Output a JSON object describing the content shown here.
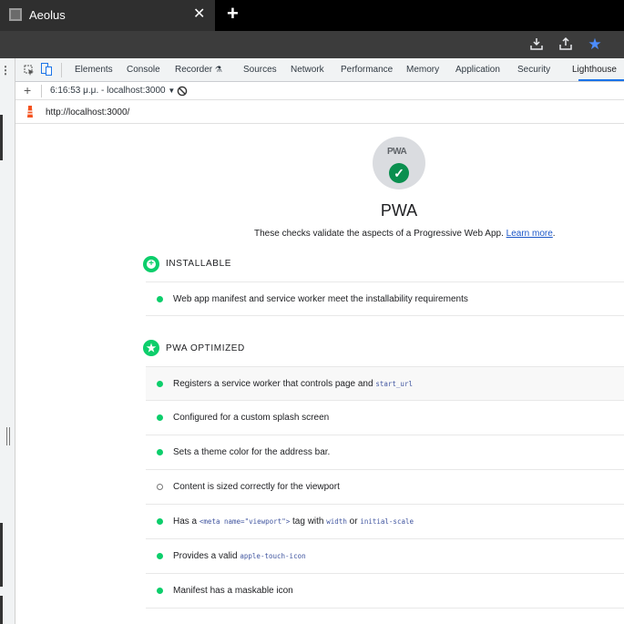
{
  "browser": {
    "tab_title": "Aeolus",
    "tab_close": "✕",
    "new_tab": "+"
  },
  "toolbar": {
    "icons": [
      "download-icon",
      "share-icon",
      "star-icon"
    ],
    "accent": "#4c8dff"
  },
  "devtools": {
    "tabs": [
      "Elements",
      "Console",
      "Recorder",
      "Sources",
      "Network",
      "Performance",
      "Memory",
      "Application",
      "Security",
      "Lighthouse"
    ],
    "active_tab": "Lighthouse",
    "sub_plus": "+",
    "report_selector": "6:16:53 μ.μ. - localhost:3000",
    "url": "http://localhost:3000/"
  },
  "pwa": {
    "logo_text": "PWA",
    "title": "PWA",
    "description": "These checks validate the aspects of a Progressive Web App.",
    "learn_more": "Learn more",
    "period": ".",
    "colors": {
      "pass": "#0cce6b",
      "check": "#0a8f4f",
      "gauge": "#dadce0",
      "link": "#1a56c8"
    }
  },
  "groups": {
    "installable": {
      "title": "INSTALLABLE",
      "audits": [
        {
          "text": "Web app manifest and service worker meet the installability requirements",
          "status": "pass"
        }
      ]
    },
    "optimized": {
      "title": "PWA OPTIMIZED",
      "audits": [
        {
          "pre": "Registers a service worker that controls page and ",
          "code": "start_url",
          "status": "pass"
        },
        {
          "text": "Configured for a custom splash screen",
          "status": "pass"
        },
        {
          "text": "Sets a theme color for the address bar.",
          "status": "pass"
        },
        {
          "text": "Content is sized correctly for the viewport",
          "status": "informative"
        },
        {
          "pre": "Has a ",
          "code1": "<meta name=\"viewport\">",
          "mid1": " tag with ",
          "code2": "width",
          "mid2": " or ",
          "code3": "initial-scale",
          "status": "pass"
        },
        {
          "pre": "Provides a valid ",
          "code": "apple-touch-icon",
          "status": "pass"
        },
        {
          "text": "Manifest has a maskable icon",
          "status": "pass"
        }
      ]
    }
  }
}
